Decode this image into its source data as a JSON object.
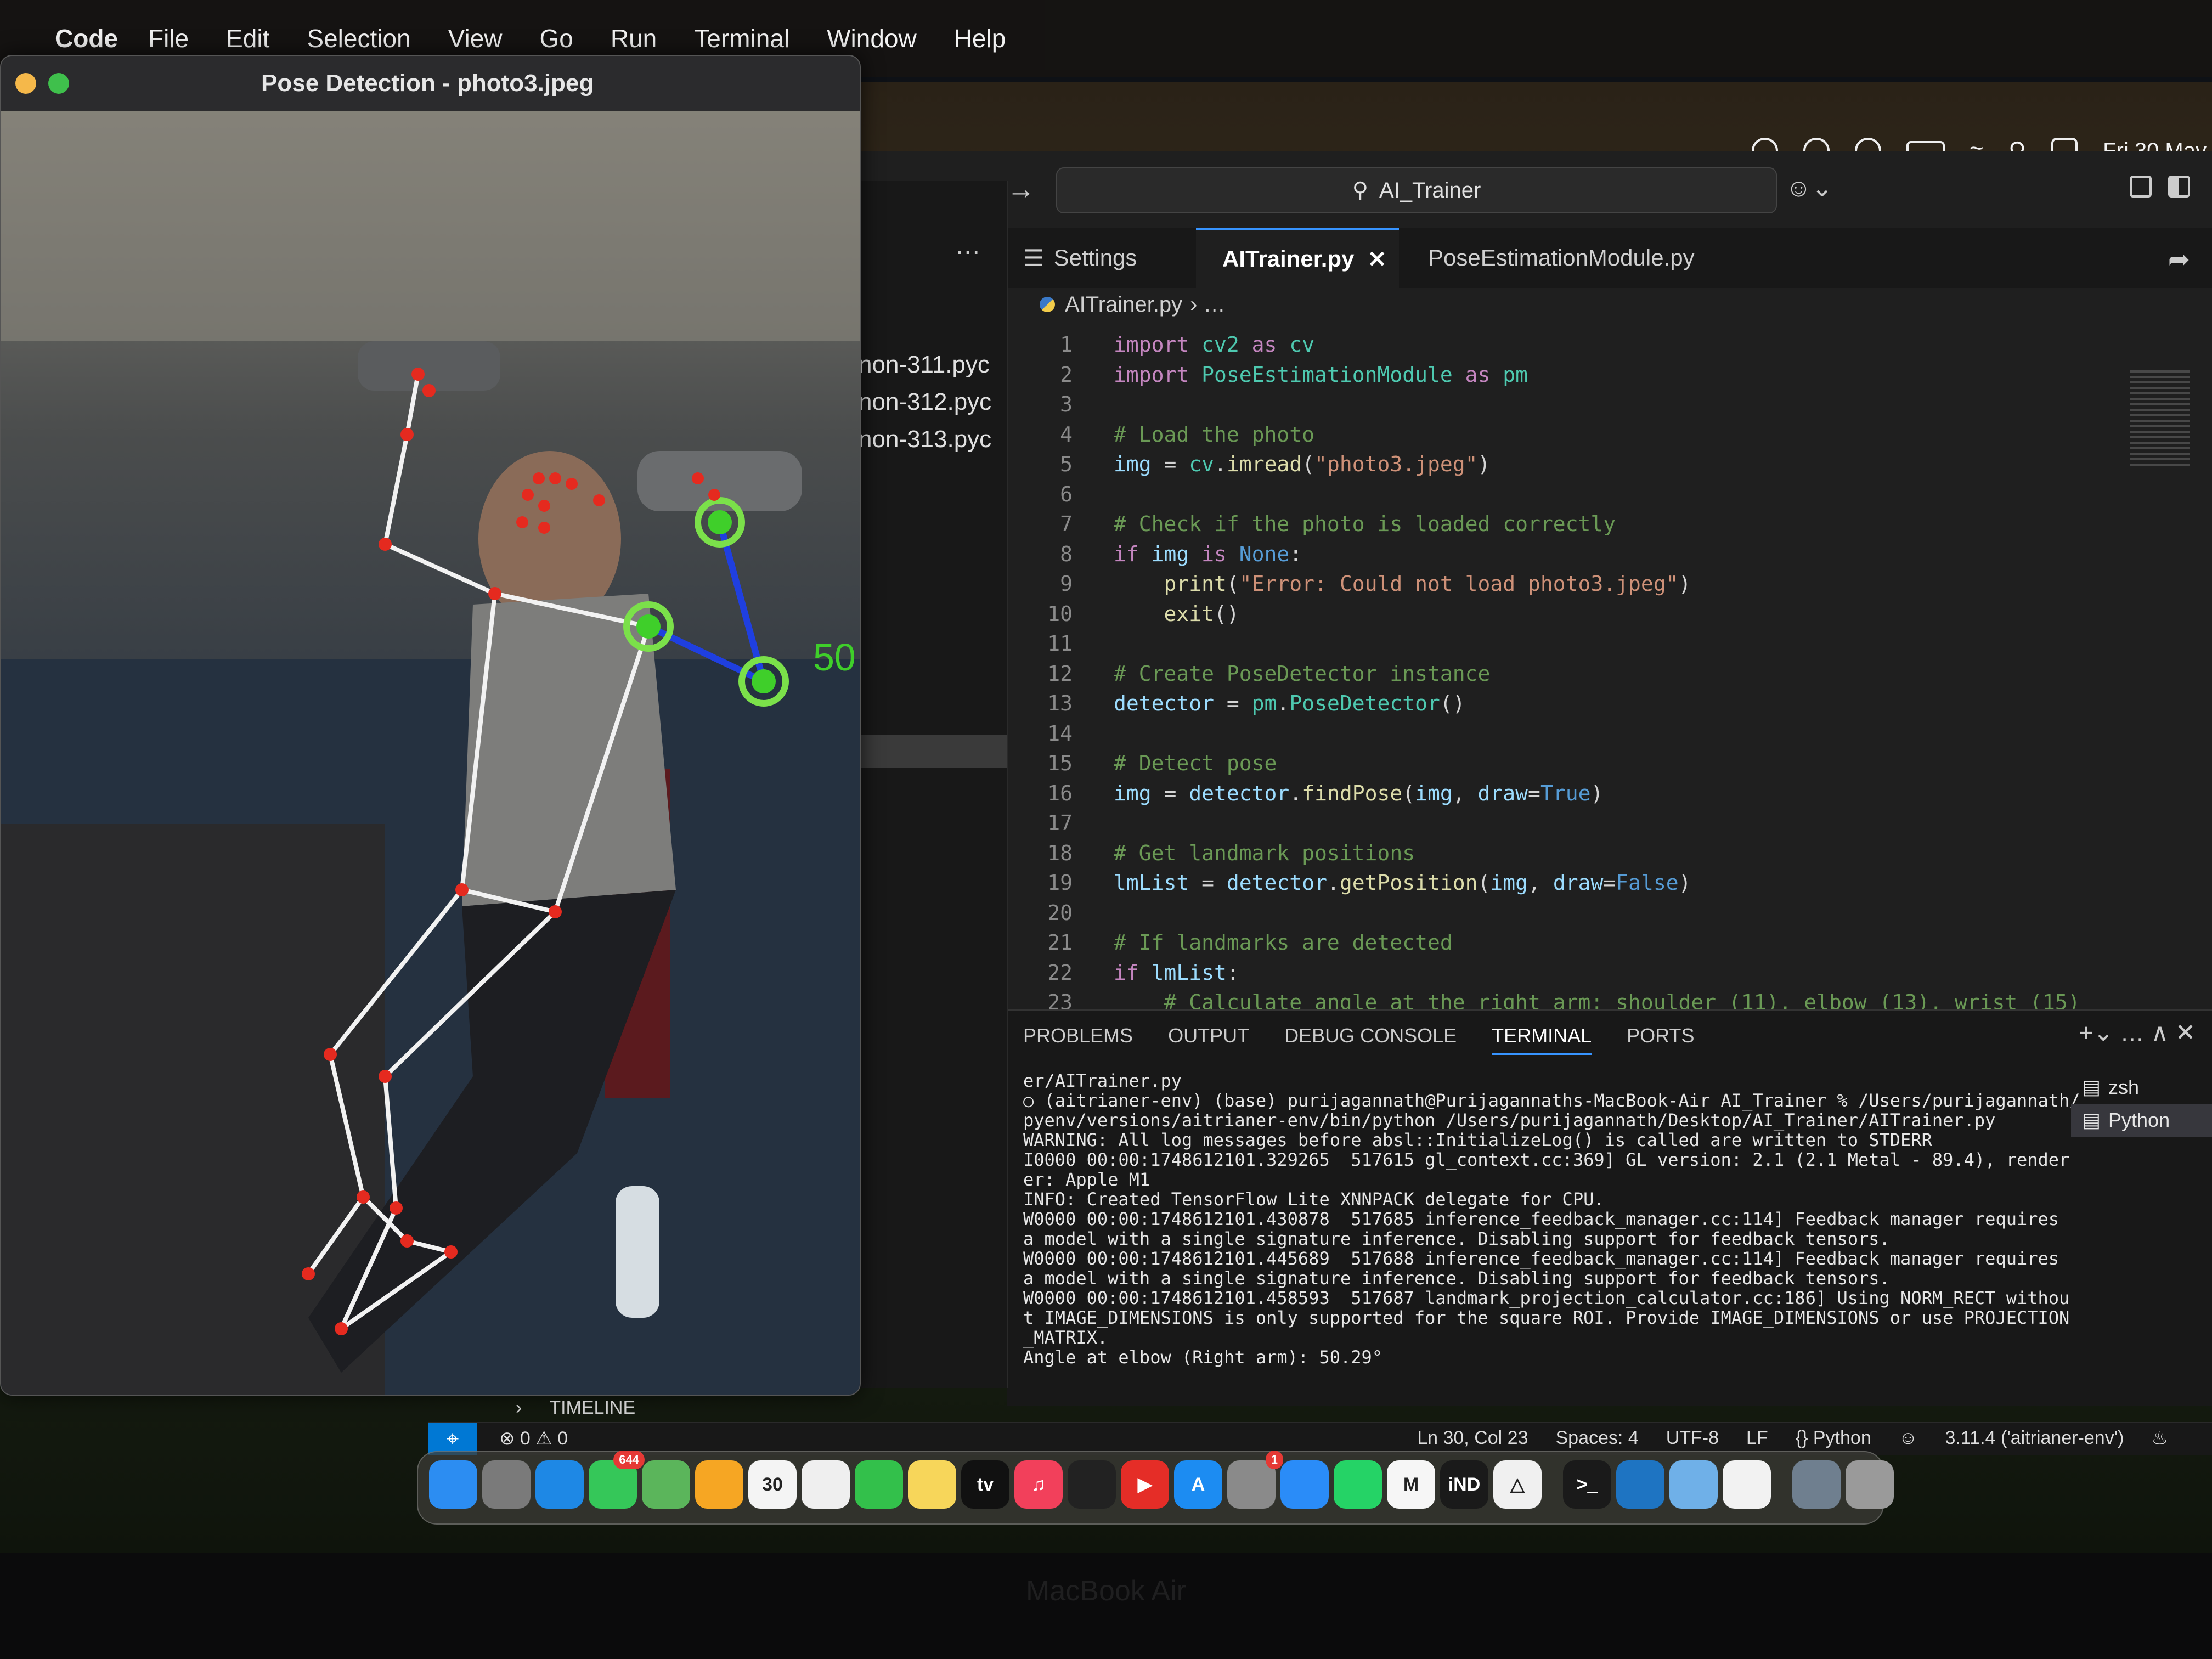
{
  "menubar": {
    "app": "Code",
    "items": [
      "File",
      "Edit",
      "Selection",
      "View",
      "Go",
      "Run",
      "Terminal",
      "Window",
      "Help"
    ],
    "clock": "Fri 30 May"
  },
  "pose_window": {
    "title": "Pose Detection - photo3.jpeg",
    "angle_overlay": "50"
  },
  "explorer": {
    "more": "…",
    "files": [
      "non-311.pyc",
      "non-312.pyc",
      "non-313.pyc"
    ]
  },
  "command_center": {
    "text": "AI_Trainer"
  },
  "tabs": [
    {
      "label": "Settings",
      "icon": "settings-icon"
    },
    {
      "label": "AITrainer.py",
      "icon": "python-icon",
      "active": true
    },
    {
      "label": "PoseEstimationModule.py",
      "icon": "python-icon"
    }
  ],
  "breadcrumb": {
    "file": "AITrainer.py",
    "rest": "› …"
  },
  "code": [
    {
      "n": "1",
      "tokens": [
        [
          "kw",
          "import "
        ],
        [
          "mod",
          "cv2"
        ],
        [
          "kw",
          " as "
        ],
        [
          "mod",
          "cv"
        ]
      ]
    },
    {
      "n": "2",
      "tokens": [
        [
          "kw",
          "import "
        ],
        [
          "mod",
          "PoseEstimationModule"
        ],
        [
          "kw",
          " as "
        ],
        [
          "mod",
          "pm"
        ]
      ]
    },
    {
      "n": "3",
      "tokens": []
    },
    {
      "n": "4",
      "tokens": [
        [
          "com",
          "# Load the photo"
        ]
      ]
    },
    {
      "n": "5",
      "tokens": [
        [
          "var",
          "img"
        ],
        [
          "txt",
          " = "
        ],
        [
          "mod",
          "cv"
        ],
        [
          "txt",
          "."
        ],
        [
          "fn",
          "imread"
        ],
        [
          "txt",
          "("
        ],
        [
          "str",
          "\"photo3.jpeg\""
        ],
        [
          "txt",
          ")"
        ]
      ]
    },
    {
      "n": "6",
      "tokens": []
    },
    {
      "n": "7",
      "tokens": [
        [
          "com",
          "# Check if the photo is loaded correctly"
        ]
      ]
    },
    {
      "n": "8",
      "tokens": [
        [
          "kw",
          "if "
        ],
        [
          "var",
          "img"
        ],
        [
          "kw",
          " is "
        ],
        [
          "con",
          "None"
        ],
        [
          "txt",
          ":"
        ]
      ]
    },
    {
      "n": "9",
      "tokens": [
        [
          "txt",
          "    "
        ],
        [
          "fn",
          "print"
        ],
        [
          "txt",
          "("
        ],
        [
          "str",
          "\"Error: Could not load photo3.jpeg\""
        ],
        [
          "txt",
          ")"
        ]
      ]
    },
    {
      "n": "10",
      "tokens": [
        [
          "txt",
          "    "
        ],
        [
          "fn",
          "exit"
        ],
        [
          "txt",
          "()"
        ]
      ]
    },
    {
      "n": "11",
      "tokens": []
    },
    {
      "n": "12",
      "tokens": [
        [
          "com",
          "# Create PoseDetector instance"
        ]
      ]
    },
    {
      "n": "13",
      "tokens": [
        [
          "var",
          "detector"
        ],
        [
          "txt",
          " = "
        ],
        [
          "mod",
          "pm"
        ],
        [
          "txt",
          "."
        ],
        [
          "mod",
          "PoseDetector"
        ],
        [
          "txt",
          "()"
        ]
      ]
    },
    {
      "n": "14",
      "tokens": []
    },
    {
      "n": "15",
      "tokens": [
        [
          "com",
          "# Detect pose"
        ]
      ]
    },
    {
      "n": "16",
      "tokens": [
        [
          "var",
          "img"
        ],
        [
          "txt",
          " = "
        ],
        [
          "var",
          "detector"
        ],
        [
          "txt",
          "."
        ],
        [
          "fn",
          "findPose"
        ],
        [
          "txt",
          "("
        ],
        [
          "var",
          "img"
        ],
        [
          "txt",
          ", "
        ],
        [
          "var",
          "draw"
        ],
        [
          "txt",
          "="
        ],
        [
          "con",
          "True"
        ],
        [
          "txt",
          ")"
        ]
      ]
    },
    {
      "n": "17",
      "tokens": []
    },
    {
      "n": "18",
      "tokens": [
        [
          "com",
          "# Get landmark positions"
        ]
      ]
    },
    {
      "n": "19",
      "tokens": [
        [
          "var",
          "lmList"
        ],
        [
          "txt",
          " = "
        ],
        [
          "var",
          "detector"
        ],
        [
          "txt",
          "."
        ],
        [
          "fn",
          "getPosition"
        ],
        [
          "txt",
          "("
        ],
        [
          "var",
          "img"
        ],
        [
          "txt",
          ", "
        ],
        [
          "var",
          "draw"
        ],
        [
          "txt",
          "="
        ],
        [
          "con",
          "False"
        ],
        [
          "txt",
          ")"
        ]
      ]
    },
    {
      "n": "20",
      "tokens": []
    },
    {
      "n": "21",
      "tokens": [
        [
          "com",
          "# If landmarks are detected"
        ]
      ]
    },
    {
      "n": "22",
      "tokens": [
        [
          "kw",
          "if "
        ],
        [
          "var",
          "lmList"
        ],
        [
          "txt",
          ":"
        ]
      ]
    },
    {
      "n": "23",
      "tokens": [
        [
          "txt",
          "    "
        ],
        [
          "com",
          "# Calculate angle at the right arm: shoulder (11), elbow (13), wrist (15)"
        ]
      ]
    }
  ],
  "panel": {
    "tabs": [
      "PROBLEMS",
      "OUTPUT",
      "DEBUG CONSOLE",
      "TERMINAL",
      "PORTS"
    ],
    "active_tab": "TERMINAL",
    "actions": "+⌄  …  ∧  ✕",
    "terminal_lines": [
      "er/AITrainer.py",
      "○ (aitrianer-env) (base) purijagannath@Purijagannaths-MacBook-Air AI_Trainer % /Users/purijagannath/.",
      "pyenv/versions/aitrianer-env/bin/python /Users/purijagannath/Desktop/AI_Trainer/AITrainer.py",
      "WARNING: All log messages before absl::InitializeLog() is called are written to STDERR",
      "I0000 00:00:1748612101.329265  517615 gl_context.cc:369] GL version: 2.1 (2.1 Metal - 89.4), render",
      "er: Apple M1",
      "INFO: Created TensorFlow Lite XNNPACK delegate for CPU.",
      "W0000 00:00:1748612101.430878  517685 inference_feedback_manager.cc:114] Feedback manager requires",
      "a model with a single signature inference. Disabling support for feedback tensors.",
      "W0000 00:00:1748612101.445689  517688 inference_feedback_manager.cc:114] Feedback manager requires",
      "a model with a single signature inference. Disabling support for feedback tensors.",
      "W0000 00:00:1748612101.458593  517687 landmark_projection_calculator.cc:186] Using NORM_RECT withou",
      "t IMAGE_DIMENSIONS is only supported for the square ROI. Provide IMAGE_DIMENSIONS or use PROJECTION",
      "_MATRIX.",
      "Angle at elbow (Right arm): 50.29°"
    ],
    "terminal_list": [
      "zsh",
      "Python"
    ]
  },
  "timeline": {
    "label": "TIMELINE"
  },
  "statusbar": {
    "problems": "⊗ 0 ⚠ 0",
    "cursor": "Ln 30, Col 23",
    "spaces": "Spaces: 4",
    "encoding": "UTF-8",
    "eol": "LF",
    "language": "{} Python",
    "interpreter": "3.11.4 ('aitrianer-env')"
  },
  "dock": {
    "items": [
      {
        "name": "finder-icon",
        "color": "#2c8df2",
        "label": ""
      },
      {
        "name": "launchpad-icon",
        "color": "#7a7a7a",
        "label": ""
      },
      {
        "name": "safari-icon",
        "color": "#1e88e5",
        "label": ""
      },
      {
        "name": "messages-icon",
        "color": "#35c759",
        "label": "",
        "badge": "644"
      },
      {
        "name": "maps-icon",
        "color": "#5bb55b",
        "label": ""
      },
      {
        "name": "photos-icon",
        "color": "#f6a623",
        "label": ""
      },
      {
        "name": "calendar-icon",
        "color": "#f4f4f4",
        "label": "30"
      },
      {
        "name": "reminders-icon",
        "color": "#efefef",
        "label": ""
      },
      {
        "name": "facetime-icon",
        "color": "#33c04b",
        "label": ""
      },
      {
        "name": "notes-icon",
        "color": "#f7d65a",
        "label": ""
      },
      {
        "name": "appletv-icon",
        "color": "#111111",
        "label": "tv"
      },
      {
        "name": "music-icon",
        "color": "#f2405b",
        "label": "♫"
      },
      {
        "name": "chatgpt-icon",
        "color": "#222222",
        "label": ""
      },
      {
        "name": "youtube-icon",
        "color": "#e52d27",
        "label": "▶"
      },
      {
        "name": "appstore-icon",
        "color": "#1c8cf2",
        "label": "A"
      },
      {
        "name": "settings-icon",
        "color": "#8a8a8a",
        "label": "",
        "badge": "1"
      },
      {
        "name": "messenger-icon",
        "color": "#2a8cf8",
        "label": ""
      },
      {
        "name": "whatsapp-icon",
        "color": "#25d366",
        "label": ""
      },
      {
        "name": "gmail-icon",
        "color": "#f6f6f6",
        "label": "M"
      },
      {
        "name": "indesign-icon",
        "color": "#1a1a1a",
        "label": "iND"
      },
      {
        "name": "arc-icon",
        "color": "#f0f0f0",
        "label": "△"
      },
      {
        "name": "terminal-icon",
        "color": "#1a1a1a",
        "label": ">_"
      },
      {
        "name": "vscode-icon",
        "color": "#1e74c2",
        "label": ""
      },
      {
        "name": "preview-icon",
        "color": "#6fb0e8",
        "label": ""
      },
      {
        "name": "document-icon",
        "color": "#f2f2f2",
        "label": ""
      },
      {
        "name": "folder-icon",
        "color": "#6f7f8f",
        "label": ""
      },
      {
        "name": "trash-icon",
        "color": "#9a9a9a",
        "label": ""
      }
    ]
  },
  "bezel": {
    "label": "MacBook Air"
  }
}
